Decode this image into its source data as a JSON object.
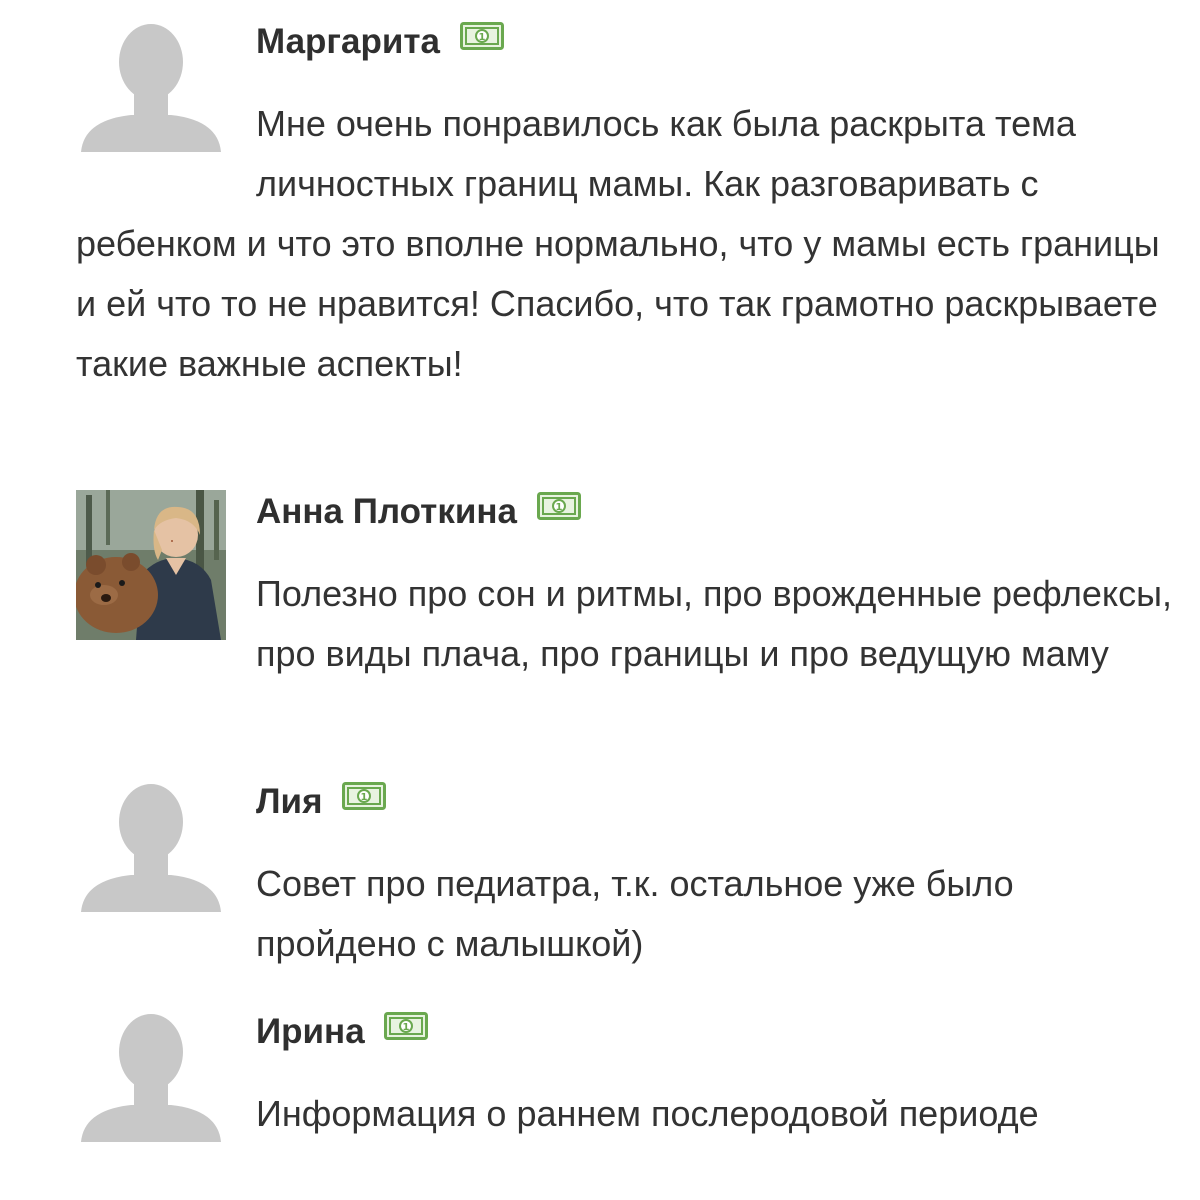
{
  "comments": [
    {
      "author": "Маргарита",
      "avatar": "default-user-icon",
      "badge_icon": "banknote-icon",
      "text": "Мне очень понравилось как была раскрыта тема личностных границ мамы. Как разговаривать с ребенком и что это вполне нормально, что у мамы есть границы и ей что то не нравится! Спасибо, что так грамотно раскрываете такие важные аспекты!"
    },
    {
      "author": "Анна Плоткина",
      "avatar": "user-photo",
      "badge_icon": "banknote-icon",
      "text": "Полезно про сон и ритмы, про врожденные рефлексы, про виды плача, про границы и про ведущую маму"
    },
    {
      "author": "Лия",
      "avatar": "default-user-icon",
      "badge_icon": "banknote-icon",
      "text": "Совет про педиатра, т.к. остальное уже было пройдено с малышкой)"
    },
    {
      "author": "Ирина",
      "avatar": "default-user-icon",
      "badge_icon": "banknote-icon",
      "text": "Информация о раннем послеродовой периоде"
    }
  ],
  "colors": {
    "text": "#333333",
    "avatar_gray": "#c8c8c8",
    "badge_green": "#6aa84f"
  }
}
